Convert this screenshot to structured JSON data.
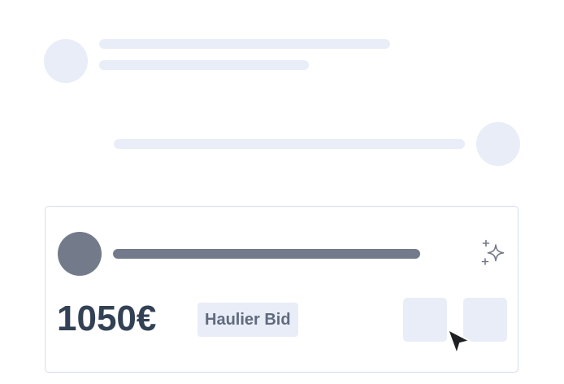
{
  "messages": [
    {
      "type": "skeleton",
      "side": "left"
    },
    {
      "type": "skeleton",
      "side": "right"
    }
  ],
  "bid_card": {
    "price": "1050€",
    "tag_label": "Haulier Bid",
    "action_icon": "sparkles-icon",
    "pointer_icon": "cursor-arrow-icon"
  },
  "colors": {
    "skeleton": "#e9edf7",
    "skeleton_dark": "#737b8a",
    "price_text": "#334155",
    "tag_text": "#606b7e",
    "card_border": "#d5dcee"
  }
}
